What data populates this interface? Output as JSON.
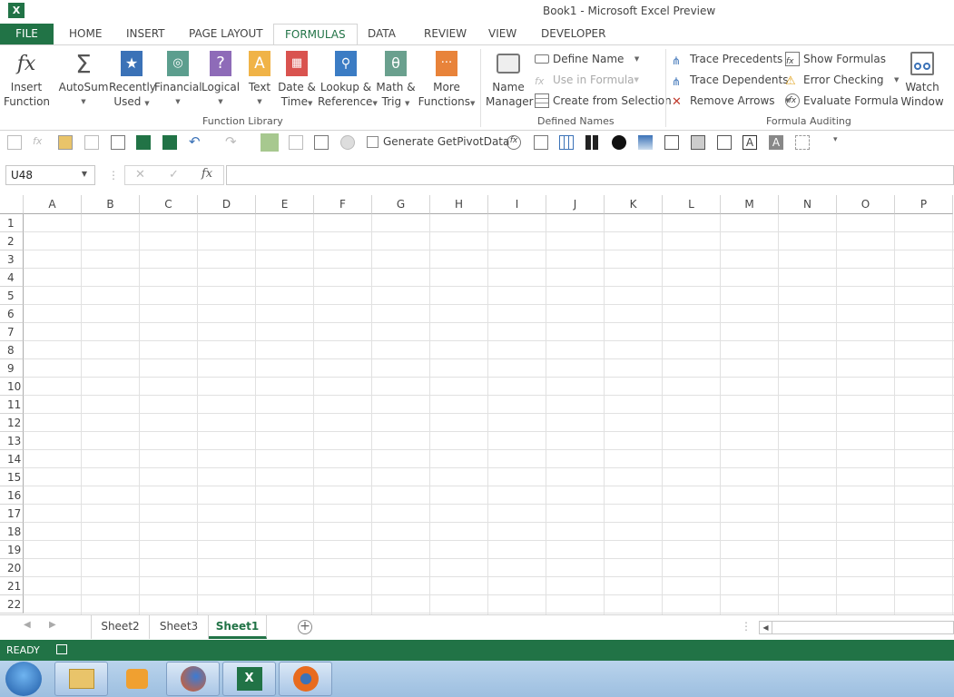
{
  "titlebar": {
    "logo": "X",
    "title": "Book1 - Microsoft Excel Preview"
  },
  "tabs": [
    "FILE",
    "HOME",
    "INSERT",
    "PAGE LAYOUT",
    "FORMULAS",
    "DATA",
    "REVIEW",
    "VIEW",
    "DEVELOPER"
  ],
  "active_tab": "FORMULAS",
  "ribbon": {
    "function_library": {
      "label": "Function Library",
      "insert_function": [
        "Insert",
        "Function"
      ],
      "autosum": "AutoSum",
      "recently_used": [
        "Recently",
        "Used"
      ],
      "financial": "Financial",
      "logical": "Logical",
      "text": "Text",
      "date_time": [
        "Date &",
        "Time"
      ],
      "lookup": [
        "Lookup &",
        "Reference"
      ],
      "math": [
        "Math &",
        "Trig"
      ],
      "more": [
        "More",
        "Functions"
      ]
    },
    "defined_names": {
      "label": "Defined Names",
      "name_manager": [
        "Name",
        "Manager"
      ],
      "define_name": "Define Name",
      "use_in_formula": "Use in Formula",
      "create_from_selection": "Create from Selection"
    },
    "formula_auditing": {
      "label": "Formula Auditing",
      "trace_precedents": "Trace Precedents",
      "trace_dependents": "Trace Dependents",
      "remove_arrows": "Remove Arrows",
      "show_formulas": "Show Formulas",
      "error_checking": "Error Checking",
      "evaluate_formula": "Evaluate Formula",
      "watch_window": [
        "Watch",
        "Window"
      ]
    }
  },
  "qat": {
    "generate_getpivotdata": "Generate GetPivotData"
  },
  "formula_bar": {
    "name_box": "U48",
    "fx": "fx",
    "cancel": "✕",
    "enter": "✓",
    "value": ""
  },
  "columns": [
    "A",
    "B",
    "C",
    "D",
    "E",
    "F",
    "G",
    "H",
    "I",
    "J",
    "K",
    "L",
    "M",
    "N",
    "O",
    "P"
  ],
  "rows": [
    "1",
    "2",
    "3",
    "4",
    "5",
    "6",
    "7",
    "8",
    "9",
    "10",
    "11",
    "12",
    "13",
    "14",
    "15",
    "16",
    "17",
    "18",
    "19",
    "20",
    "21",
    "22"
  ],
  "sheets": [
    "Sheet2",
    "Sheet3",
    "Sheet1"
  ],
  "active_sheet": "Sheet1",
  "status": {
    "text": "READY"
  },
  "colors": {
    "accent": "#217346"
  }
}
